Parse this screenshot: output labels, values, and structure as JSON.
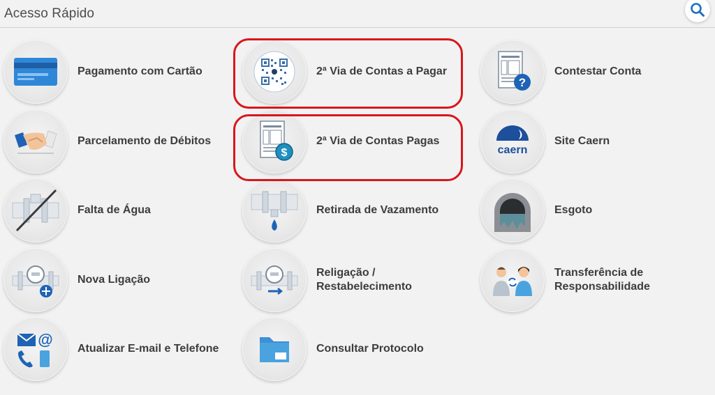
{
  "header": {
    "title": "Acesso Rápido"
  },
  "colors": {
    "highlight": "#d8161b",
    "icon_blue": "#1f7bd0",
    "icon_grey": "#7b8a9a"
  },
  "tiles": [
    {
      "label": "Pagamento com Cartão",
      "icon": "credit-card-icon"
    },
    {
      "label": "2ª Via de Contas a Pagar",
      "icon": "qr-code-icon"
    },
    {
      "label": "Contestar Conta",
      "icon": "bill-question-icon"
    },
    {
      "label": "Parcelamento de Débitos",
      "icon": "handshake-icon"
    },
    {
      "label": "2ª Via de Contas Pagas",
      "icon": "bill-paid-icon"
    },
    {
      "label": "Site Caern",
      "icon": "caern-logo-icon",
      "logo_text": "caern"
    },
    {
      "label": "Falta de Água",
      "icon": "no-water-pipe-icon"
    },
    {
      "label": "Retirada de Vazamento",
      "icon": "leak-pipe-icon"
    },
    {
      "label": "Esgoto",
      "icon": "sewer-icon"
    },
    {
      "label": "Nova Ligação",
      "icon": "meter-add-icon"
    },
    {
      "label": "Religação /\nRestabelecimento",
      "icon": "meter-reconnect-icon"
    },
    {
      "label": "Transferência de\nResponsabilidade",
      "icon": "people-transfer-icon"
    },
    {
      "label": "Atualizar E-mail e Telefone",
      "icon": "email-phone-icon"
    },
    {
      "label": "Consultar Protocolo",
      "icon": "folder-icon"
    }
  ]
}
